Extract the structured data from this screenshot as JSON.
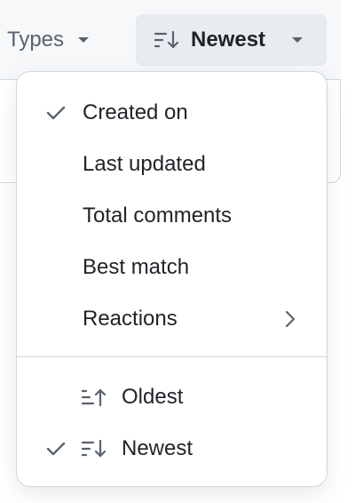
{
  "toolbar": {
    "types_label": "Types",
    "sort_label": "Newest"
  },
  "menu": {
    "criteria": [
      {
        "label": "Created on",
        "checked": true
      },
      {
        "label": "Last updated",
        "checked": false
      },
      {
        "label": "Total comments",
        "checked": false
      },
      {
        "label": "Best match",
        "checked": false
      },
      {
        "label": "Reactions",
        "checked": false,
        "has_submenu": true
      }
    ],
    "order": [
      {
        "label": "Oldest",
        "icon": "sort-ascending-icon",
        "checked": false
      },
      {
        "label": "Newest",
        "icon": "sort-descending-icon",
        "checked": true
      }
    ]
  },
  "colors": {
    "text": "#1f2328",
    "muted": "#59636e",
    "border": "#d0d7de",
    "button_bg": "#e8ebef"
  }
}
